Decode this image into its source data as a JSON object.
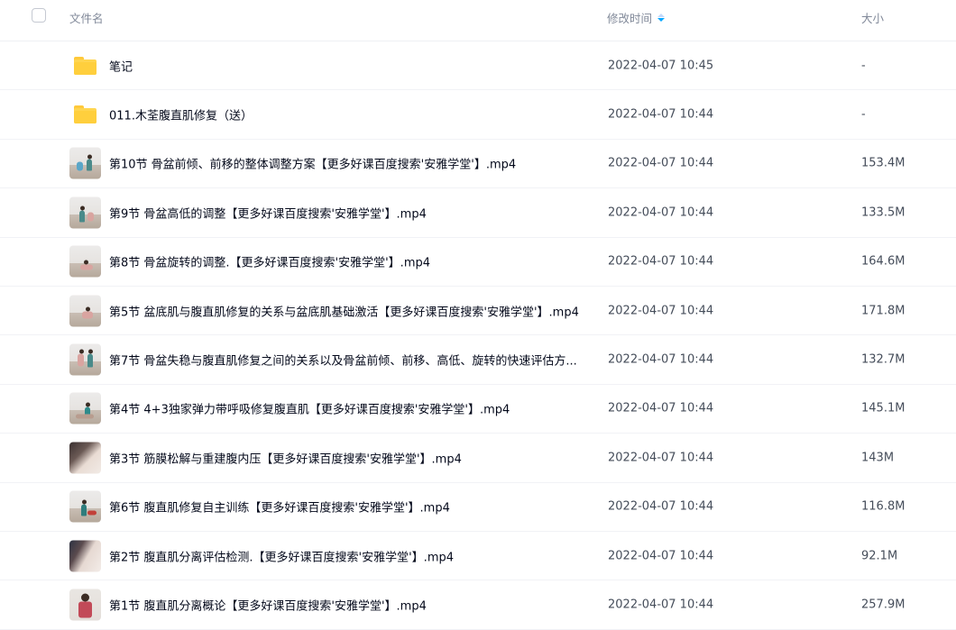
{
  "header": {
    "name_label": "文件名",
    "time_label": "修改时间",
    "size_label": "大小"
  },
  "rows": [
    {
      "type": "folder",
      "name": "笔记",
      "time": "2022-04-07 10:45",
      "size": "-"
    },
    {
      "type": "folder",
      "name": "011.木荃腹直肌修复（送）",
      "time": "2022-04-07 10:44",
      "size": "-"
    },
    {
      "type": "video",
      "name": "第10节 骨盆前倾、前移的整体调整方案【更多好课百度搜索'安雅学堂'】.mp4",
      "time": "2022-04-07 10:44",
      "size": "153.4M"
    },
    {
      "type": "video",
      "name": "第9节 骨盆高低的调整【更多好课百度搜索'安雅学堂'】.mp4",
      "time": "2022-04-07 10:44",
      "size": "133.5M"
    },
    {
      "type": "video",
      "name": "第8节 骨盆旋转的调整.【更多好课百度搜索'安雅学堂'】.mp4",
      "time": "2022-04-07 10:44",
      "size": "164.6M"
    },
    {
      "type": "video",
      "name": "第5节 盆底肌与腹直肌修复的关系与盆底肌基础激活【更多好课百度搜索'安雅学堂'】.mp4",
      "time": "2022-04-07 10:44",
      "size": "171.8M"
    },
    {
      "type": "video",
      "name": "第7节 骨盆失稳与腹直肌修复之间的关系以及骨盆前倾、前移、高低、旋转的快速评估方...",
      "time": "2022-04-07 10:44",
      "size": "132.7M"
    },
    {
      "type": "video",
      "name": "第4节 4+3独家弹力带呼吸修复腹直肌【更多好课百度搜索'安雅学堂'】.mp4",
      "time": "2022-04-07 10:44",
      "size": "145.1M"
    },
    {
      "type": "video",
      "name": "第3节 筋膜松解与重建腹内压【更多好课百度搜索'安雅学堂'】.mp4",
      "time": "2022-04-07 10:44",
      "size": "143M"
    },
    {
      "type": "video",
      "name": "第6节 腹直肌修复自主训练【更多好课百度搜索'安雅学堂'】.mp4",
      "time": "2022-04-07 10:44",
      "size": "116.8M"
    },
    {
      "type": "video",
      "name": "第2节 腹直肌分离评估检测.【更多好课百度搜索'安雅学堂'】.mp4",
      "time": "2022-04-07 10:44",
      "size": "92.1M"
    },
    {
      "type": "video",
      "name": "第1节 腹直肌分离概论【更多好课百度搜索'安雅学堂'】.mp4",
      "time": "2022-04-07 10:44",
      "size": "257.9M"
    }
  ],
  "colors": {
    "folder": "#ffd54f",
    "sort_active": "#06a7ff",
    "header_text": "#818999"
  },
  "icons": {
    "folder": "folder-icon",
    "video": "video-thumbnail",
    "sort": "sort-desc-icon"
  }
}
